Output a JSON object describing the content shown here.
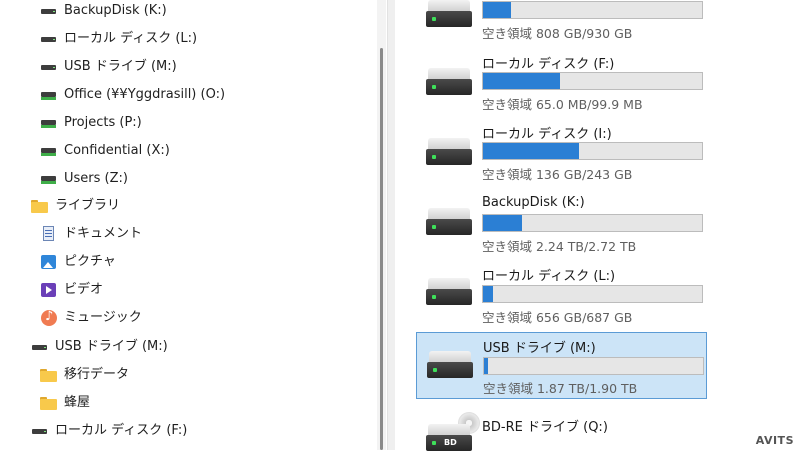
{
  "nav": {
    "items": [
      {
        "label": "BackupDisk (K:)",
        "icon": "drive-icon"
      },
      {
        "label": "ローカル ディスク (L:)",
        "icon": "drive-icon"
      },
      {
        "label": "USB ドライブ (M:)",
        "icon": "drive-icon"
      },
      {
        "label": "Office (¥¥Yggdrasill) (O:)",
        "icon": "network-drive-icon"
      },
      {
        "label": "Projects (P:)",
        "icon": "network-drive-icon"
      },
      {
        "label": "Confidential (X:)",
        "icon": "network-drive-icon"
      },
      {
        "label": "Users (Z:)",
        "icon": "network-drive-icon"
      },
      {
        "label": "ライブラリ",
        "icon": "folder-icon"
      },
      {
        "label": "ドキュメント",
        "icon": "documents-icon"
      },
      {
        "label": "ピクチャ",
        "icon": "pictures-icon"
      },
      {
        "label": "ビデオ",
        "icon": "videos-icon"
      },
      {
        "label": "ミュージック",
        "icon": "music-icon"
      },
      {
        "label": "USB ドライブ (M:)",
        "icon": "drive-icon"
      },
      {
        "label": "移行データ",
        "icon": "folder-icon"
      },
      {
        "label": "蜂屋",
        "icon": "folder-icon"
      },
      {
        "label": "ローカル ディスク (F:)",
        "icon": "drive-icon"
      }
    ]
  },
  "drives": [
    {
      "name": "",
      "free": "空き領域 808 GB/930 GB",
      "used_fraction": 0.13,
      "selected": false
    },
    {
      "name": "ローカル ディスク (F:)",
      "free": "空き領域 65.0 MB/99.9 MB",
      "used_fraction": 0.35,
      "selected": false
    },
    {
      "name": "ローカル ディスク (I:)",
      "free": "空き領域 136 GB/243 GB",
      "used_fraction": 0.44,
      "selected": false
    },
    {
      "name": "BackupDisk (K:)",
      "free": "空き領域 2.24 TB/2.72 TB",
      "used_fraction": 0.18,
      "selected": false
    },
    {
      "name": "ローカル ディスク (L:)",
      "free": "空き領域 656 GB/687 GB",
      "used_fraction": 0.045,
      "selected": false
    },
    {
      "name": "USB ドライブ (M:)",
      "free": "空き領域 1.87 TB/1.90 TB",
      "used_fraction": 0.016,
      "selected": true
    },
    {
      "name": "BD-RE ドライブ (Q:)",
      "free": "",
      "used_fraction": null,
      "selected": false
    }
  ],
  "bd_icon_text": "BD",
  "watermark": "AVITS",
  "colors": {
    "accent": "#2b7fd4",
    "selection": "#cce4f7",
    "selection_border": "#5b9bd5"
  }
}
